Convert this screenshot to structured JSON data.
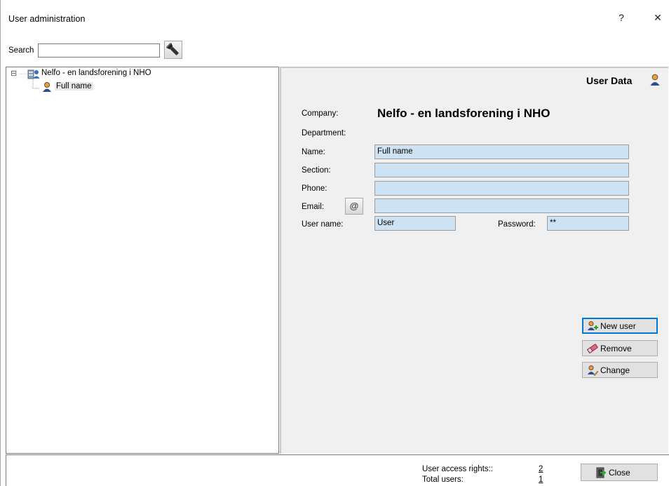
{
  "window": {
    "title": "User administration",
    "help_glyph": "?",
    "close_glyph": "✕"
  },
  "search": {
    "label": "Search",
    "value": "",
    "button_icon": "flashlight-icon"
  },
  "tree": {
    "company": "Nelfo - en landsforening i NHO",
    "expander": "⊟",
    "user": "Full name"
  },
  "user_data": {
    "header": "User Data",
    "company_label": "Company:",
    "company_value": "Nelfo - en landsforening i NHO",
    "department_label": "Department:",
    "name_label": "Name:",
    "name_value": "Full name",
    "section_label": "Section:",
    "section_value": "",
    "phone_label": "Phone:",
    "phone_value": "",
    "email_label": "Email:",
    "email_value": "",
    "email_button_glyph": "@",
    "username_label": "User name:",
    "username_value": "User",
    "password_label": "Password:",
    "password_value": "**"
  },
  "actions": {
    "new_user": "New user",
    "remove": "Remove",
    "change": "Change"
  },
  "footer": {
    "access_rights_label": "User access rights::",
    "access_rights_value": "2",
    "total_users_label": "Total users:",
    "total_users_value": "1",
    "close": "Close"
  }
}
